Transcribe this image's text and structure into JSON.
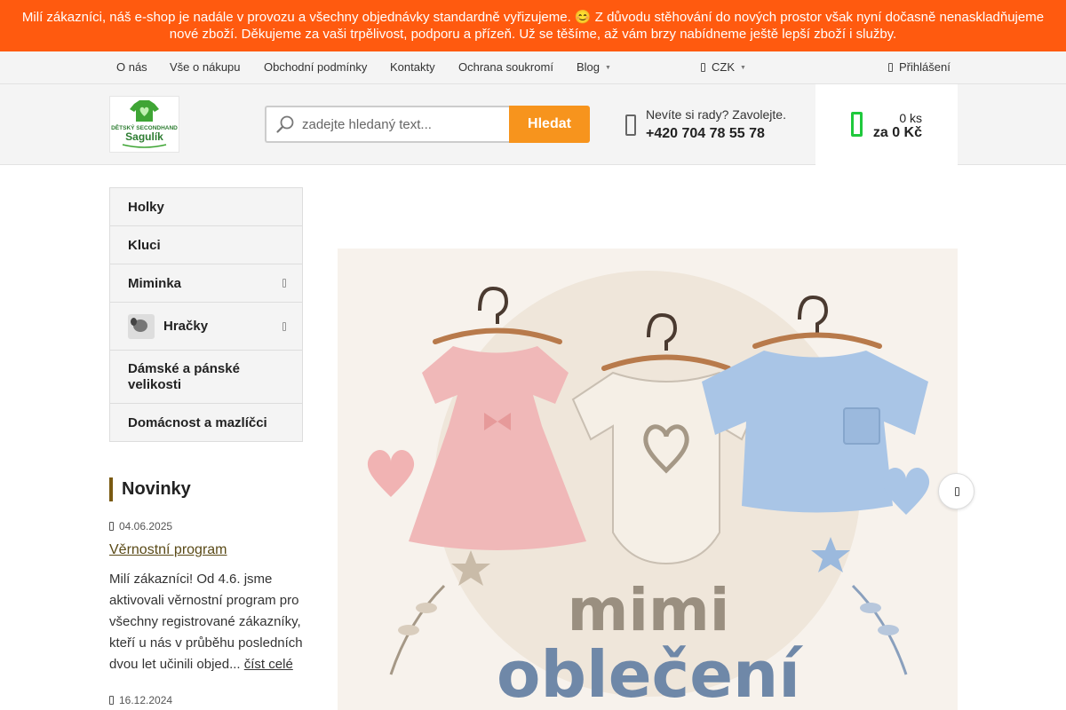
{
  "announcement": {
    "line1": "Milí zákazníci, náš e-shop je nadále v provozu a všechny objednávky standardně vyřizujeme. 😊 Z důvodu stěhování do nových prostor však nyní dočasně nenaskladňujeme",
    "line2": "nové zboží. Děkujeme za vaši trpělivost, podporu a přízeň. Už se těšíme, až vám brzy nabídneme ještě lepší zboží i služby."
  },
  "topnav": {
    "links": [
      "O nás",
      "Vše o nákupu",
      "Obchodní podmínky",
      "Kontakty",
      "Ochrana soukromí",
      "Blog"
    ],
    "currency": "CZK",
    "login": "Přihlášení"
  },
  "logo": {
    "text_top": "DĚTSKÝ SECONDHAND",
    "text_main": "Sagulík"
  },
  "search": {
    "placeholder": "zadejte hledaný text...",
    "button": "Hledat"
  },
  "contact": {
    "prompt": "Nevíte si rady? Zavolejte.",
    "phone": "+420 704 78 55 78"
  },
  "cart": {
    "count": "0 ks",
    "total": "za 0 Kč"
  },
  "categories": [
    {
      "label": "Holky"
    },
    {
      "label": "Kluci"
    },
    {
      "label": "Miminka"
    },
    {
      "label": "Hračky"
    },
    {
      "label": "Dámské a pánské velikosti"
    },
    {
      "label": "Domácnost a mazlíčci"
    }
  ],
  "news": {
    "title": "Novinky",
    "items": [
      {
        "date": "04.06.2025",
        "headline": "Věrnostní program",
        "excerpt": "Milí zákazníci! Od 4.6. jsme aktivovali věrnostní program pro všechny registrované zákazníky, kteří u nás v průběhu posledních dvou let učinili objed...",
        "more": "číst celé"
      },
      {
        "date": "16.12.2024"
      }
    ]
  },
  "slider": {
    "line1": "mimi",
    "line2": "oblečení"
  },
  "colors": {
    "banner": "#ff5a0f",
    "search_button": "#f7941d",
    "cart_icon": "#1fc93c",
    "news_accent": "#7a5a12"
  }
}
